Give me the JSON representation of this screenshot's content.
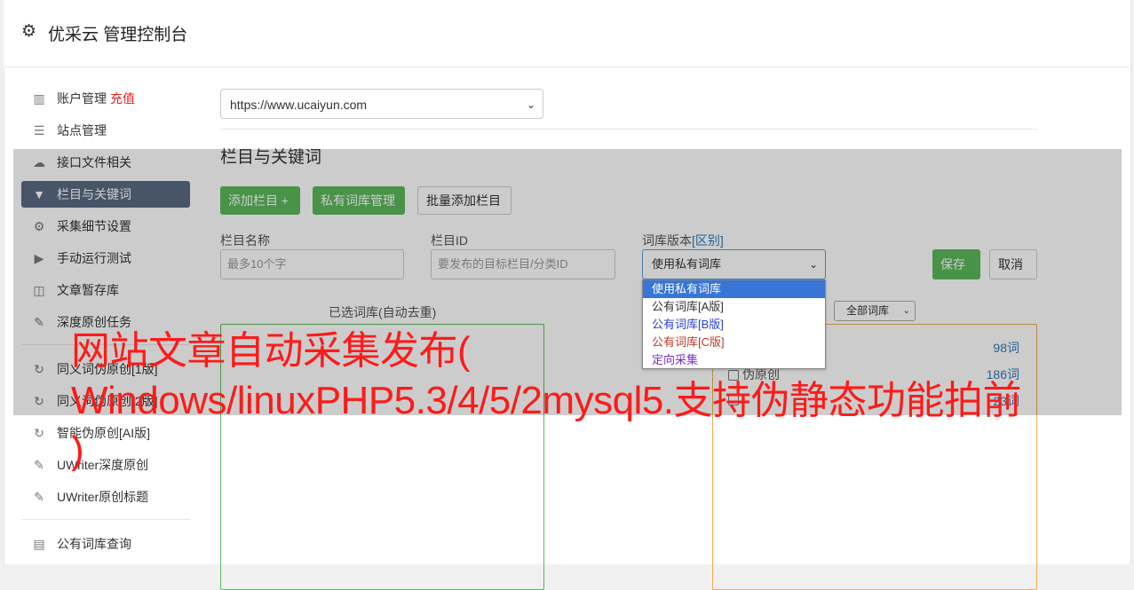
{
  "header": {
    "title": "优采云 管理控制台"
  },
  "sidebar": {
    "items": [
      {
        "label": "账户管理",
        "badge": "充值",
        "icon": "bar-chart-icon"
      },
      {
        "label": "站点管理",
        "icon": "server-icon"
      },
      {
        "label": "接口文件相关",
        "icon": "cloud-upload-icon"
      },
      {
        "label": "栏目与关键词",
        "icon": "filter-icon",
        "active": true
      },
      {
        "label": "采集细节设置",
        "icon": "cogs-icon"
      },
      {
        "label": "手动运行测试",
        "icon": "play-icon"
      },
      {
        "label": "文章暂存库",
        "icon": "database-icon"
      },
      {
        "label": "深度原创任务",
        "icon": "edit-icon"
      }
    ],
    "items2": [
      {
        "label": "同义词伪原创[1版]",
        "icon": "refresh-icon"
      },
      {
        "label": "同义词伪原创[2版]",
        "icon": "refresh-icon"
      },
      {
        "label": "智能伪原创[AI版]",
        "icon": "refresh-icon"
      },
      {
        "label": "UWriter深度原创",
        "icon": "edit-icon"
      },
      {
        "label": "UWriter原创标题",
        "icon": "edit-icon"
      }
    ],
    "items3": [
      {
        "label": "公有词库查询",
        "icon": "book-icon"
      }
    ]
  },
  "main": {
    "site_url": "https://www.ucaiyun.com",
    "section_title": "栏目与关键词",
    "buttons": {
      "add_column": "添加栏目 +",
      "private_lib": "私有词库管理",
      "batch_add": "批量添加栏目"
    },
    "form": {
      "name_label": "栏目名称",
      "name_placeholder": "最多10个字",
      "id_label": "栏目ID",
      "id_placeholder": "要发布的目标栏目/分类ID",
      "lib_label": "词库版本",
      "lib_diff_link": "[区别]",
      "lib_selected": "使用私有词库",
      "save": "保存",
      "cancel": "取消"
    },
    "left_panel_caption": "已选词库(自动去重)",
    "lib_filter": "全部词库",
    "right_rows": [
      {
        "label": "",
        "count": "98词"
      },
      {
        "label": "伪原创",
        "count": "186词"
      },
      {
        "label": "",
        "count": "23词"
      }
    ],
    "dropdown_options": [
      {
        "label": "使用私有词库",
        "style": "sel"
      },
      {
        "label": "公有词库[A版]",
        "style": "c-black"
      },
      {
        "label": "公有词库[B版]",
        "style": "c-blue"
      },
      {
        "label": "公有词库[C版]",
        "style": "c-red"
      },
      {
        "label": "定向采集",
        "style": "c-purple"
      }
    ]
  },
  "watermark": {
    "line1": "网站文章自动采集发布(",
    "line2": "Windows/linuxPHP5.3/4/5/2mysql5.支持伪静态功能拍前",
    "line3": ")"
  },
  "colors": {
    "accent_green": "#5cb85c",
    "active_nav": "#5a6b82",
    "recharge_red": "#e02020",
    "watermark_red": "#ff1a1a"
  }
}
